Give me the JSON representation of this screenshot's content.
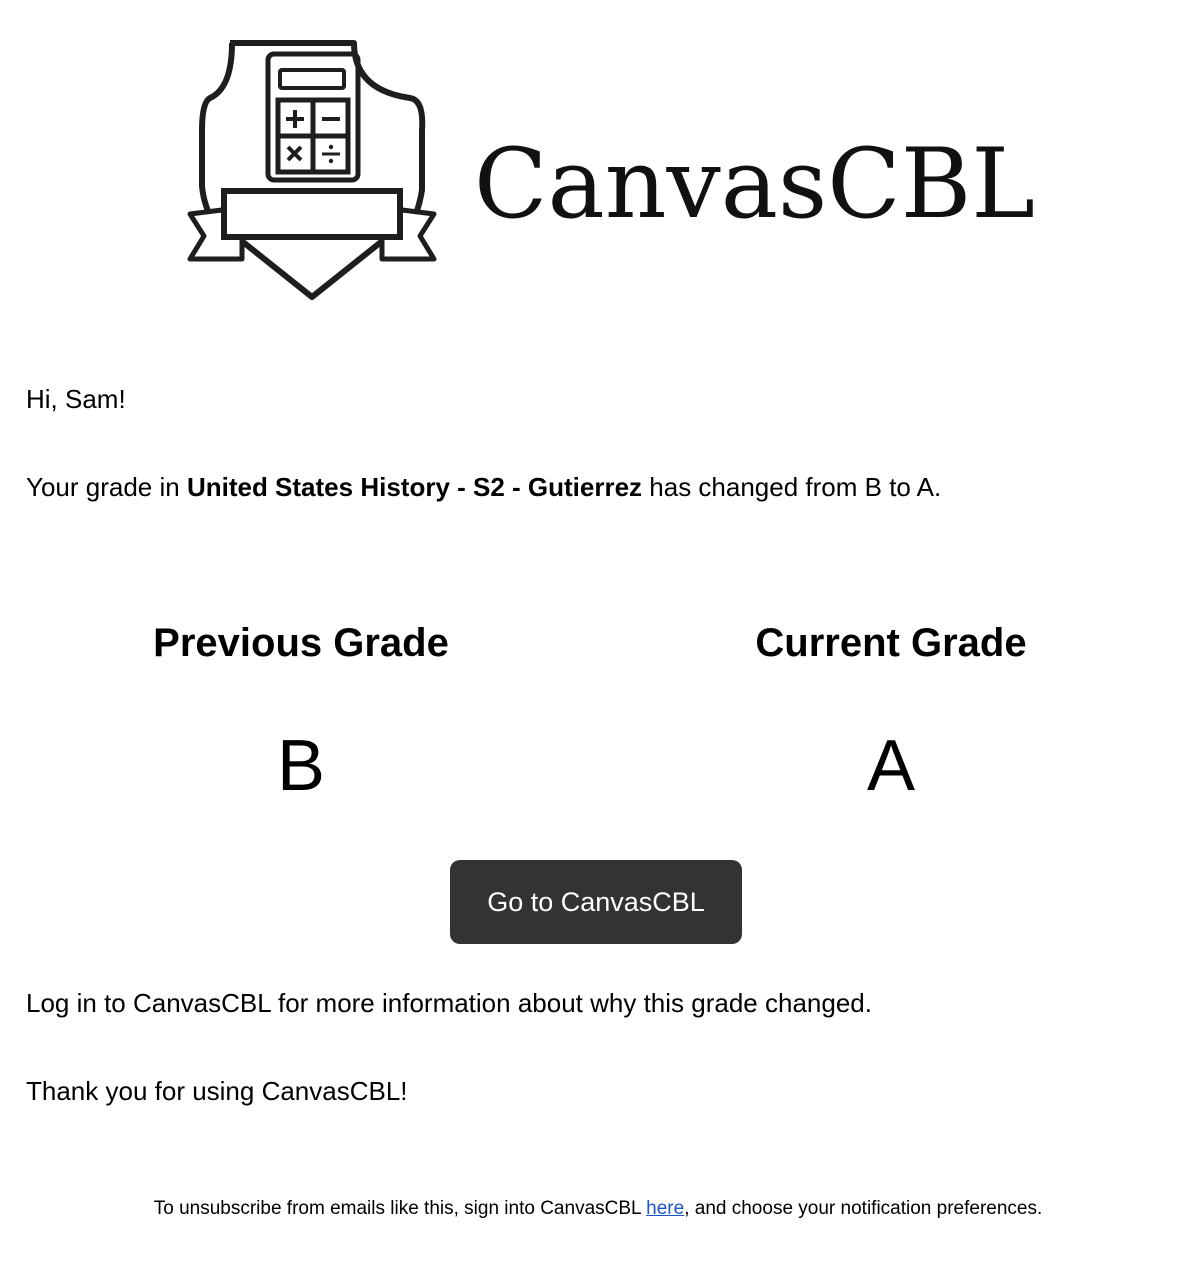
{
  "header": {
    "logo_icon": "calculator-shield-icon",
    "brand_name": "CanvasCBL"
  },
  "message": {
    "greeting": "Hi, Sam!",
    "change_prefix": "Your grade in ",
    "course_name": "United States History - S2 - Gutierrez",
    "change_suffix": " has changed from B to A."
  },
  "grades": {
    "previous_label": "Previous Grade",
    "previous_value": "B",
    "current_label": "Current Grade",
    "current_value": "A"
  },
  "cta": {
    "label": "Go to CanvasCBL",
    "background": "#333333",
    "text_color": "#ffffff"
  },
  "body_text": {
    "info": "Log in to CanvasCBL for more information about why this grade changed.",
    "thanks": "Thank you for using CanvasCBL!"
  },
  "footer": {
    "prefix": "To unsubscribe from emails like this, sign into CanvasCBL ",
    "link_text": "here",
    "suffix": ", and choose your notification preferences.",
    "link_color": "#1a56c8"
  }
}
